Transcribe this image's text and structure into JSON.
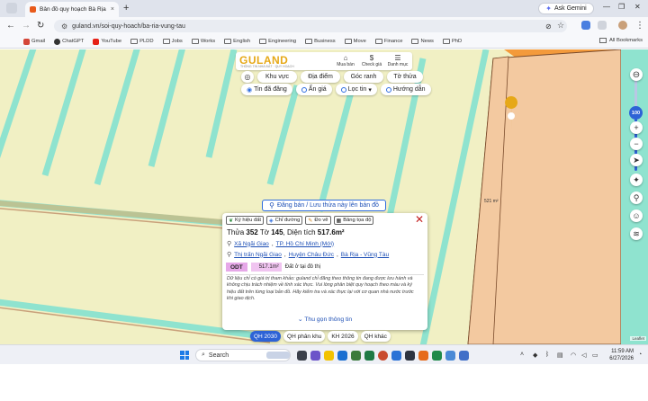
{
  "browser": {
    "tab_title": "Bản đồ quy hoạch Bà Rịa - Vũng Tàu",
    "tab_close": "×",
    "new_tab": "+",
    "ask_gemini": "Ask Gemini",
    "url": "guland.vn/soi-quy-hoach/ba-ria-vung-tau",
    "all_bookmarks": "All Bookmarks",
    "bookmarks": [
      "Gmail",
      "ChatGPT",
      "YouTube",
      "PLDD",
      "Jobs",
      "Works",
      "English",
      "Engineering",
      "Business",
      "Move",
      "Finance",
      "News",
      "PhD"
    ]
  },
  "guland": {
    "logo": "GULAND",
    "logo_sub": "THÔNG TIN NHÀ ĐẤT · QUY HOẠCH",
    "top_actions": [
      {
        "icon": "store-icon",
        "label": "Mua bán"
      },
      {
        "icon": "dollar-icon",
        "label": "Check giá"
      },
      {
        "icon": "list-icon",
        "label": "Danh mục"
      }
    ],
    "row1": [
      "Khu vực",
      "Địa điểm",
      "Góc ranh",
      "Tờ thửa"
    ],
    "row2": [
      "Tin đã đăng",
      "Ẩn giá",
      "Lọc tin",
      "Hướng dẫn"
    ],
    "zoom_level": "100",
    "register_banner": "Đăng bán / Lưu thửa này lên bản đồ",
    "parcel_area_label": "521 m²"
  },
  "card": {
    "actions": [
      "Ký hiệu đất",
      "Chỉ đường",
      "Đo vẽ",
      "Bảng tọa độ"
    ],
    "parcel_prefix": "Thửa",
    "parcel_no": "352",
    "sheet_prefix": "Tờ",
    "sheet_no": "145",
    "area_prefix": ", Diện tích",
    "area": "517.6m²",
    "loc1": {
      "ward": "Xã Ngãi Giao",
      "city": "TP. Hồ Chí Minh (Mới)"
    },
    "loc2": {
      "town": "Thị trấn Ngãi Giao",
      "district": "Huyện Châu Đức",
      "province": "Bà Rịa - Vũng Tàu"
    },
    "land_code": "ODT",
    "land_area": "517.1m²",
    "land_desc": "Đất ở tại đô thị",
    "disclaimer": "Dữ liệu chỉ có giá trị tham khảo: guland chỉ đăng theo thông tin đang được lưu hành và không chịu trách nhiệm về tính xác thực. Vui lòng phân biệt quy hoạch theo màu và ký hiệu đất trên từng loại bản đồ. Hãy kiểm tra và xác thực lại với cơ quan nhà nước trước khi giao dịch.",
    "collapse": "Thu gọn thông tin"
  },
  "layers": [
    {
      "label": "QH 2030",
      "active": true
    },
    {
      "label": "QH phân khu",
      "active": false
    },
    {
      "label": "KH 2026",
      "active": false
    },
    {
      "label": "QH khác",
      "active": false
    }
  ],
  "leaflet": "Leaflet",
  "taskbar": {
    "search": "Search",
    "time": "11:59 AM",
    "date": "6/27/2026"
  },
  "colors": {
    "map_bg": "#f1f0c4",
    "road": "#8fe3cf",
    "parcel": "#f3c9a0",
    "orange_zone": "#f39a3b",
    "accent": "#2d63d6"
  }
}
